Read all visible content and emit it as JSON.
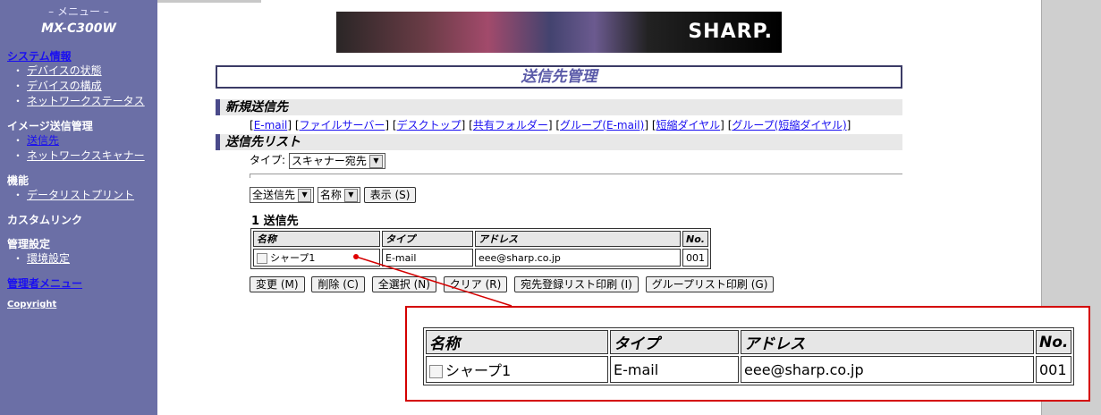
{
  "sidebar": {
    "menu_title": "– メニュー –",
    "model": "MX-C300W",
    "sections": [
      {
        "title": "システム情報",
        "items": [
          "デバイスの状態",
          "デバイスの構成",
          "ネットワークステータス"
        ]
      },
      {
        "title": "イメージ送信管理",
        "items": [
          "送信先",
          "ネットワークスキャナー"
        ]
      },
      {
        "title": "機能",
        "items": [
          "データリストプリント"
        ]
      },
      {
        "title": "カスタムリンク",
        "items": []
      },
      {
        "title": "管理設定",
        "items": [
          "環境設定"
        ]
      },
      {
        "title": "管理者メニュー",
        "items": []
      },
      {
        "title": "Copyright",
        "items": []
      }
    ]
  },
  "banner": {
    "logo": "SHARP."
  },
  "page_title": "送信先管理",
  "new_dest": {
    "heading": "新規送信先",
    "links": [
      "E-mail",
      "ファイルサーバー",
      "デスクトップ",
      "共有フォルダー",
      "グループ(E-mail)",
      "短縮ダイヤル",
      "グループ(短縮ダイヤル)"
    ]
  },
  "dest_list": {
    "heading": "送信先リスト",
    "type_label": "タイプ:",
    "type_value": "スキャナー宛先",
    "filter_value": "全送信先",
    "sort_value": "名称",
    "show_button": "表示 (S)",
    "count": "1 送信先",
    "columns": [
      "名称",
      "タイプ",
      "アドレス",
      "No."
    ],
    "rows": [
      {
        "name": "シャープ1",
        "type": "E-mail",
        "address": "eee@sharp.co.jp",
        "no": "001"
      }
    ],
    "buttons": [
      "変更 (M)",
      "削除 (C)",
      "全選択 (N)",
      "クリア (R)",
      "宛先登録リスト印刷 (I)",
      "グループリスト印刷 (G)"
    ]
  },
  "colors": {
    "sidebar_bg": "#6b6fa6",
    "callout_border": "#d40000",
    "link": "#1a0ff0"
  }
}
